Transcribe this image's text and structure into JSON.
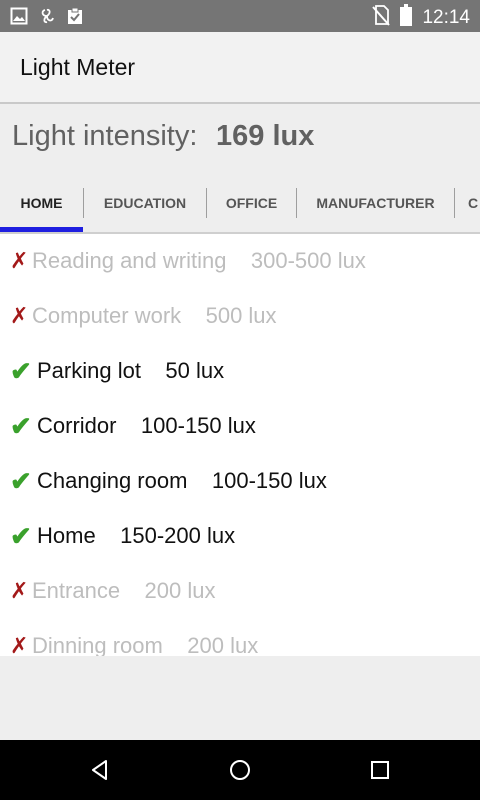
{
  "status_bar": {
    "time": "12:14",
    "left_icons": [
      "image-icon",
      "pinwheel-icon",
      "clipboard-check-icon"
    ],
    "right_icons": [
      "no-sim-icon",
      "battery-icon"
    ]
  },
  "app_bar": {
    "title": "Light Meter"
  },
  "intensity": {
    "label": "Light intensity: ",
    "value": "169 lux"
  },
  "tabs": [
    {
      "label": "HOME",
      "selected": true
    },
    {
      "label": "EDUCATION",
      "selected": false
    },
    {
      "label": "OFFICE",
      "selected": false
    },
    {
      "label": "MANUFACTURER",
      "selected": false
    },
    {
      "label": "C",
      "selected": false
    }
  ],
  "items": [
    {
      "text": "Reading and writing    300-500 lux",
      "ok": false,
      "mark": "✗"
    },
    {
      "text": "Computer work    500 lux",
      "ok": false,
      "mark": "✗"
    },
    {
      "text": "Parking lot    50 lux",
      "ok": true,
      "mark": "✔"
    },
    {
      "text": "Corridor    100-150 lux",
      "ok": true,
      "mark": "✔"
    },
    {
      "text": "Changing room    100-150 lux",
      "ok": true,
      "mark": "✔"
    },
    {
      "text": "Home    150-200 lux",
      "ok": true,
      "mark": "✔"
    },
    {
      "text": "Entrance    200 lux",
      "ok": false,
      "mark": "✗"
    },
    {
      "text": "Dinning room    200 lux",
      "ok": false,
      "mark": "✗"
    }
  ],
  "colors": {
    "tab_indicator": "#1f1fe0",
    "ok": "#3aa12c",
    "not_ok": "#a31919",
    "status_bar": "#757575"
  },
  "nav_bar": {
    "buttons": [
      "back-icon",
      "home-icon",
      "recents-icon"
    ]
  }
}
